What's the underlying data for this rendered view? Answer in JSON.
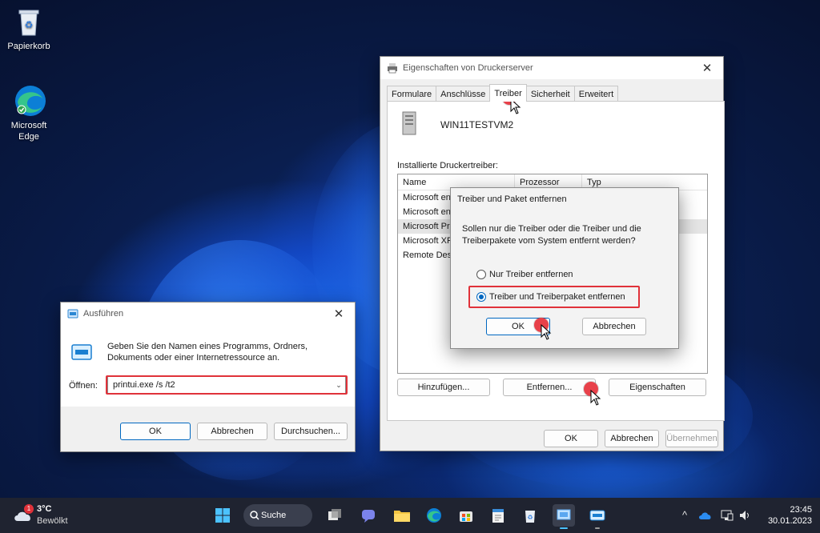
{
  "desktop": {
    "icons": [
      {
        "label": "Papierkorb",
        "icon": "recycle-bin-icon"
      },
      {
        "label": "Microsoft\nEdge",
        "icon": "edge-icon"
      }
    ]
  },
  "printserver": {
    "title": "Eigenschaften von Druckerserver",
    "tabs": [
      "Formulare",
      "Anschlüsse",
      "Treiber",
      "Sicherheit",
      "Erweitert"
    ],
    "active_tab": "Treiber",
    "server_name": "WIN11TESTVM2",
    "installed_label": "Installierte Druckertreiber:",
    "columns": [
      "Name",
      "Prozessor",
      "Typ"
    ],
    "rows": [
      "Microsoft en",
      "Microsoft en",
      "Microsoft Pr",
      "Microsoft XP",
      "Remote Desk"
    ],
    "buttons": {
      "add": "Hinzufügen...",
      "remove": "Entfernen...",
      "props": "Eigenschaften",
      "ok": "OK",
      "cancel": "Abbrechen",
      "apply": "Übernehmen"
    }
  },
  "remove_dialog": {
    "title": "Treiber und Paket entfernen",
    "question": "Sollen nur die Treiber oder die Treiber und die Treiberpakete vom System entfernt werden?",
    "option1": "Nur Treiber entfernen",
    "option2": "Treiber und Treiberpaket entfernen",
    "selected": "option2",
    "ok": "OK",
    "cancel": "Abbrechen"
  },
  "run_dialog": {
    "title": "Ausführen",
    "description": "Geben Sie den Namen eines Programms, Ordners, Dokuments oder einer Internetressource an.",
    "open_label": "Öffnen:",
    "command": "printui.exe /s /t2",
    "ok": "OK",
    "cancel": "Abbrechen",
    "browse": "Durchsuchen..."
  },
  "taskbar": {
    "weather_temp": "3°C",
    "weather_desc": "Bewölkt",
    "weather_badge": "1",
    "search_label": "Suche",
    "time": "23:45",
    "date": "30.01.2023"
  },
  "colors": {
    "highlight_red": "#e0323a",
    "accent": "#0067c0"
  }
}
